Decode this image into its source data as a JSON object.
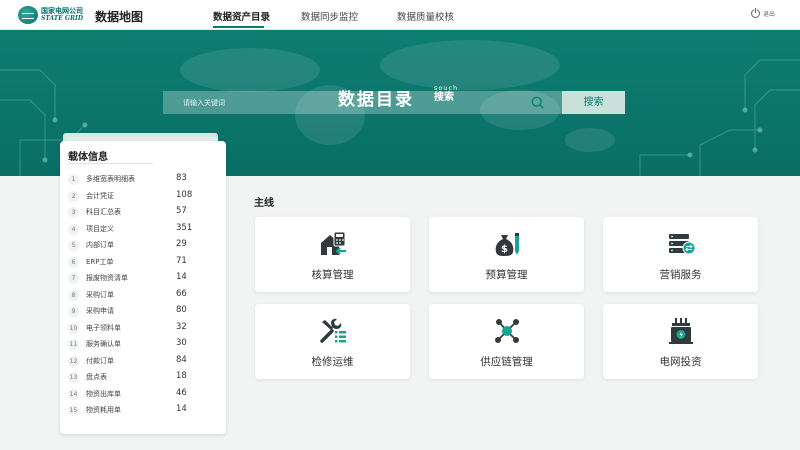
{
  "header": {
    "logo_cn": "国家电网公司",
    "logo_en": "STATE GRID",
    "app_title": "数据地图",
    "tabs": [
      {
        "label": "数据资产目录",
        "active": true
      },
      {
        "label": "数据同步监控",
        "active": false
      },
      {
        "label": "数据质量校核",
        "active": false
      }
    ],
    "logout_label": "退出"
  },
  "banner": {
    "title": "数据目录",
    "sub_en": "souch",
    "sub_cn": "搜索",
    "search_placeholder": "请输入关键词",
    "search_button": "搜索"
  },
  "panel": {
    "title": "载体信息",
    "rows": [
      {
        "idx": "1",
        "name": "多维宽表明细表",
        "count": "83"
      },
      {
        "idx": "2",
        "name": "会计凭证",
        "count": "108"
      },
      {
        "idx": "3",
        "name": "科目汇总表",
        "count": "57"
      },
      {
        "idx": "4",
        "name": "项目定义",
        "count": "351"
      },
      {
        "idx": "5",
        "name": "内部订单",
        "count": "29"
      },
      {
        "idx": "6",
        "name": "ERP工单",
        "count": "71"
      },
      {
        "idx": "7",
        "name": "报废物资清单",
        "count": "14"
      },
      {
        "idx": "8",
        "name": "采购订单",
        "count": "66"
      },
      {
        "idx": "9",
        "name": "采购申请",
        "count": "80"
      },
      {
        "idx": "10",
        "name": "电子领料单",
        "count": "32"
      },
      {
        "idx": "11",
        "name": "服务确认单",
        "count": "30"
      },
      {
        "idx": "12",
        "name": "付款订单",
        "count": "84"
      },
      {
        "idx": "13",
        "name": "盘点表",
        "count": "18"
      },
      {
        "idx": "14",
        "name": "物资出库单",
        "count": "46"
      },
      {
        "idx": "15",
        "name": "物资耗用单",
        "count": "14"
      }
    ]
  },
  "main": {
    "section_title": "主线",
    "cards": [
      {
        "label": "核算管理",
        "icon": "accounting-icon"
      },
      {
        "label": "预算管理",
        "icon": "budget-icon"
      },
      {
        "label": "营销服务",
        "icon": "marketing-icon"
      },
      {
        "label": "检修运维",
        "icon": "maintenance-icon"
      },
      {
        "label": "供应链管理",
        "icon": "supply-chain-icon"
      },
      {
        "label": "电网投资",
        "icon": "grid-investment-icon"
      }
    ]
  },
  "colors": {
    "brand": "#0d7a70",
    "banner": "#0b7269",
    "icon_dark": "#2f3a3c",
    "icon_teal": "#17a394"
  }
}
